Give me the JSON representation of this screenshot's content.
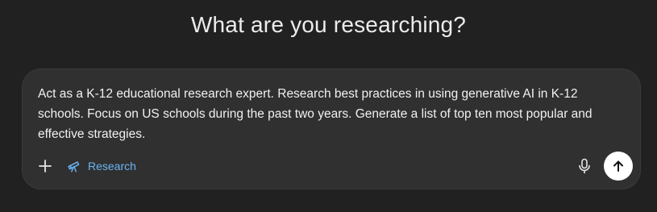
{
  "heading": "What are you researching?",
  "composer": {
    "prompt_text": "Act as a K-12 educational research expert. Research best practices in using generative AI in K-12 schools. Focus on US schools during the past two years. Generate a list of top ten most popular and effective strategies.",
    "toolbar": {
      "add_icon": "plus-icon",
      "research_icon": "telescope-icon",
      "research_label": "Research",
      "mic_icon": "microphone-icon",
      "send_icon": "arrow-up-icon"
    }
  },
  "colors": {
    "background": "#212121",
    "composer_bg": "#303030",
    "text": "#f1f1f1",
    "accent": "#6ab4f5",
    "send_bg": "#ffffff"
  }
}
